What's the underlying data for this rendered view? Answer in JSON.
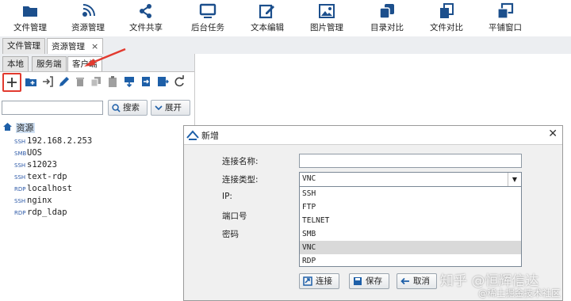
{
  "toolbar": {
    "items": [
      {
        "label": "文件管理",
        "icon": "folder-icon"
      },
      {
        "label": "资源管理",
        "icon": "satellite-icon"
      },
      {
        "label": "文件共享",
        "icon": "share-icon"
      },
      {
        "label": "后台任务",
        "icon": "monitor-icon"
      },
      {
        "label": "文本编辑",
        "icon": "edit-icon"
      },
      {
        "label": "图片管理",
        "icon": "image-icon"
      },
      {
        "label": "目录对比",
        "icon": "copy-icon"
      },
      {
        "label": "文件对比",
        "icon": "file-compare-icon"
      },
      {
        "label": "平铺窗口",
        "icon": "windows-icon"
      }
    ]
  },
  "doc_tabs": {
    "tab1": "文件管理",
    "tab2": "资源管理",
    "close": "×"
  },
  "sub_tabs": {
    "local": "本地",
    "server": "服务端",
    "client": "客户端"
  },
  "icon_bar": [
    "add-icon",
    "new-folder-icon",
    "import-icon",
    "edit-icon",
    "delete-icon",
    "copy-icon",
    "paste-icon",
    "download-icon",
    "export-icon",
    "export-file-icon",
    "refresh-icon"
  ],
  "search": {
    "placeholder": "",
    "search_label": "搜索",
    "expand_label": "展开"
  },
  "tree": {
    "root": "资源",
    "items": [
      {
        "proto": "SSH",
        "name": "192.168.2.253"
      },
      {
        "proto": "SMB",
        "name": "UOS"
      },
      {
        "proto": "SSH",
        "name": "s12023"
      },
      {
        "proto": "SSH",
        "name": "text-rdp"
      },
      {
        "proto": "RDP",
        "name": "localhost"
      },
      {
        "proto": "SSH",
        "name": "nginx"
      },
      {
        "proto": "RDP",
        "name": "rdp_ldap"
      }
    ]
  },
  "dialog": {
    "title": "新增",
    "close": "✕",
    "labels": {
      "name": "连接名称:",
      "type": "连接类型:",
      "ip": "IP:",
      "port": "端口号",
      "password": "密码"
    },
    "type_value": "VNC",
    "type_options": [
      "SSH",
      "FTP",
      "TELNET",
      "SMB",
      "VNC",
      "RDP"
    ],
    "selected_option": "VNC",
    "buttons": {
      "connect": "连接",
      "save": "保存",
      "cancel": "取消"
    }
  },
  "watermark": {
    "main": "知乎 @恒辉信达",
    "sub": "@稀土掘金技术社区"
  },
  "colors": {
    "accent_blue": "#1d5fa8",
    "annotation_red": "#e23a2f",
    "selected_row": "#d9d9d9"
  }
}
